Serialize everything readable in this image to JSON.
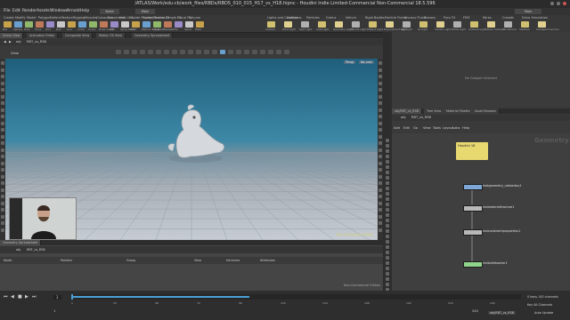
{
  "app": {
    "title": "/ATLAS/Work/edu-cb/work_files/RBDs/RBDS_010_015_H17_vs_H18.hipnc - Houdini Indie Limited-Commercial Non-Commercial 18.5.596"
  },
  "menu": [
    "File",
    "Edit",
    "Render",
    "Assets",
    "Windows",
    "Arnold",
    "Help"
  ],
  "build": "Build",
  "main_label": "Main",
  "shelf": {
    "tabs": [
      "Create",
      "Modify",
      "Model",
      "Polygon",
      "Deform",
      "Texture",
      "Rigging",
      "Muscles",
      "Characters",
      "Constraints",
      "Hair Utils",
      "Guide Process",
      "Guide Brushes",
      "Terrain FX",
      "Simple FX",
      "Cloud FX",
      "Volume"
    ],
    "tools": [
      "Box",
      "Sphere",
      "Tube",
      "Torus",
      "Grid",
      "Null",
      "Line",
      "Circle",
      "Curve",
      "Draw Curve",
      "Path",
      "Spray Paint",
      "Font",
      "Platonic Solids",
      "L-System",
      "Metaball",
      "File",
      "Spiral",
      "Helix"
    ],
    "right_tabs": [
      "Lights and Cameras",
      "Collisions",
      "Particles",
      "Grains",
      "Vellum",
      "Rigid Bodies",
      "Particle Fluids",
      "Viscous Fluids",
      "Oceans",
      "Pyro FX",
      "FEM",
      "Wires",
      "Crowds",
      "Drive Simulation"
    ],
    "right_tools": [
      "Camera",
      "Point Light",
      "Spot Light",
      "Area Light",
      "Geometry Light",
      "Volume Light",
      "Distant Light",
      "Environment Light",
      "Sky Light",
      "GI Light",
      "Caustic Light",
      "Portal Light",
      "Ambient Light",
      "Stereo Camera",
      "VR Camera",
      "Switcher",
      "Gamepad Camera"
    ]
  },
  "viewer": {
    "tabs": [
      "Scene View",
      "Animation Editor",
      "Composite View",
      "Motion FX View",
      "Geometry Spreadsheet"
    ],
    "path": "obj",
    "node": "RBT_vs_RSB",
    "view_label": "View",
    "persp": "Persp",
    "cam": "No cam",
    "watermark": "Non-Commercial Edition"
  },
  "right_top": {
    "message": "No Gadget Selected"
  },
  "network": {
    "tabs": [
      "obj/RBT_vs_RSB",
      "Tree View",
      "Material Palette",
      "Asset Browser"
    ],
    "menu": [
      "Add",
      "Edit",
      "Go",
      "View",
      "Tools",
      "Layout",
      "Labs",
      "Help"
    ],
    "context_label": "Geometry",
    "sticky": "Houdini 18",
    "nodes": [
      {
        "name": "testgeometry_rubbertoy1"
      },
      {
        "name": "rbdmaterialfracture1"
      },
      {
        "name": "rbdconstraintproperties1"
      },
      {
        "name": "rbdbulletsolver1"
      }
    ]
  },
  "spreadsheet": {
    "tab": "Geometry Spreadsheet",
    "path": "obj",
    "node": "RBT_vs_RSB",
    "nodes_label": "Node:",
    "columns": [
      "Pointed",
      "Group",
      "View",
      "Intrinsics",
      "Attributes"
    ],
    "watermark": "Non-Commercial Edition"
  },
  "timeline": {
    "current_frame": "1",
    "start": "1",
    "end": "240",
    "ticks": [
      "1",
      "24",
      "48",
      "72",
      "96",
      "120",
      "144",
      "168",
      "192",
      "216",
      "240"
    ],
    "keys": "0 keys, 0/0 channels",
    "key_all": "Key All Channels",
    "auto_update": "Auto Update",
    "status_tab": "obj/RBT_vs_RSB"
  },
  "colors": {
    "accent": "#4a9fd4",
    "sticky": "#e8d870",
    "node_blue": "#7ea7d8",
    "node_gray": "#b8b8b8",
    "node_green": "#8fd48a"
  }
}
